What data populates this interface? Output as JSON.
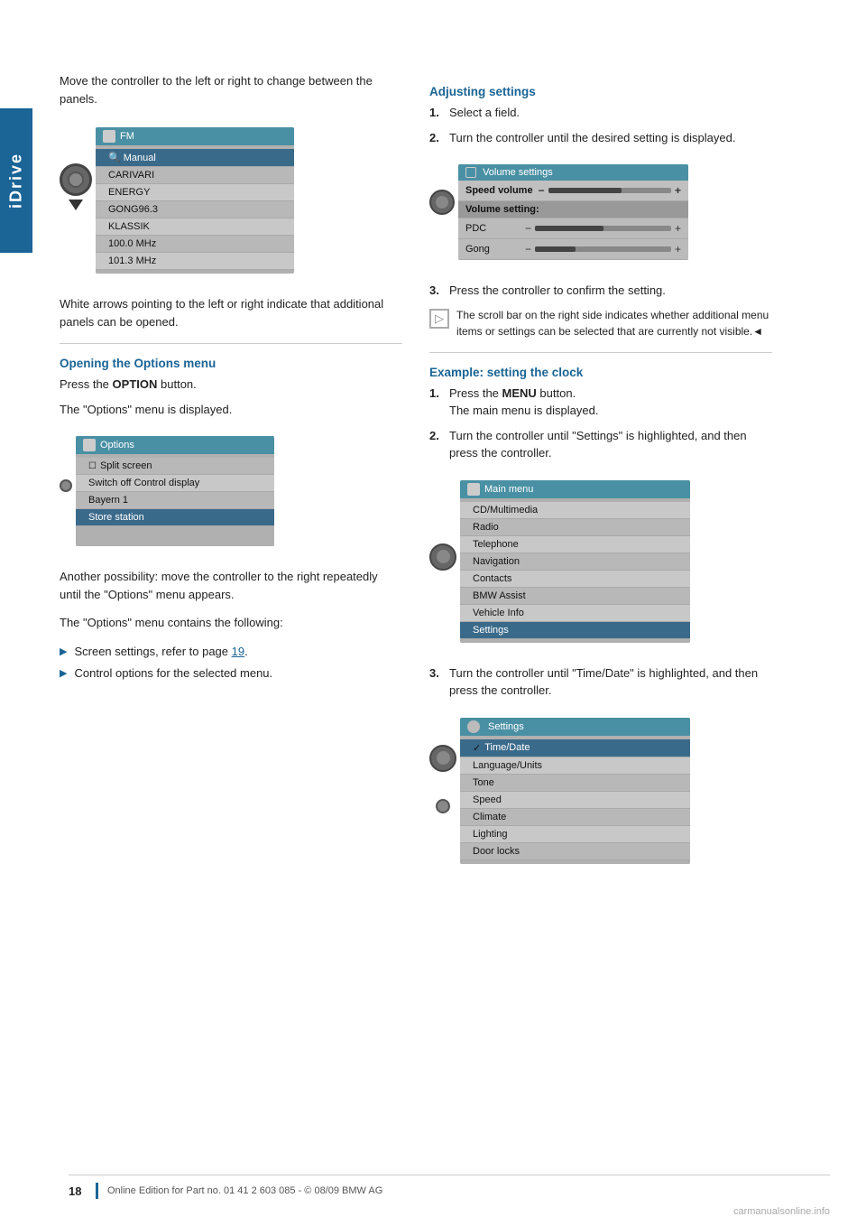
{
  "page": {
    "idrive_label": "iDrive",
    "page_number": "18",
    "footer_text": "Online Edition for Part no. 01 41 2 603 085 - © 08/09 BMW AG"
  },
  "left_column": {
    "intro_text": "Move the controller to the left or right to change between the panels.",
    "fm_screen": {
      "header": "FM",
      "rows": [
        {
          "label": "Manual",
          "style": "highlighted"
        },
        {
          "label": "CARIVARI",
          "style": "normal"
        },
        {
          "label": "ENERGY",
          "style": "normal"
        },
        {
          "label": "GONG96.3",
          "style": "normal"
        },
        {
          "label": "KLASSIK",
          "style": "normal"
        },
        {
          "label": "100.0 MHz",
          "style": "normal"
        },
        {
          "label": "101.3 MHz",
          "style": "normal"
        }
      ]
    },
    "arrows_text": "White arrows pointing to the left or right indicate that additional panels can be opened.",
    "options_heading": "Opening the Options menu",
    "options_step1": "Press the",
    "options_step1_bold": "OPTION",
    "options_step1_end": "button.",
    "options_step2": "The \"Options\" menu is displayed.",
    "options_screen": {
      "header": "Options",
      "rows": [
        {
          "label": "Split screen",
          "icon": "checkbox",
          "style": "normal"
        },
        {
          "label": "Switch off Control display",
          "style": "normal"
        },
        {
          "label": "Bayern 1",
          "style": "normal"
        },
        {
          "label": "Store station",
          "style": "highlighted"
        }
      ]
    },
    "another_text": "Another possibility: move the controller to the right repeatedly until the \"Options\" menu appears.",
    "contains_text": "The \"Options\" menu contains the following:",
    "bullets": [
      {
        "text": "Screen settings, refer to page ",
        "link": "19",
        "suffix": "."
      },
      {
        "text": "Control options for the selected menu."
      }
    ]
  },
  "right_column": {
    "adjusting_heading": "Adjusting settings",
    "adjusting_steps": [
      {
        "num": "1.",
        "text": "Select a field."
      },
      {
        "num": "2.",
        "text": "Turn the controller until the desired setting is displayed."
      }
    ],
    "volume_screen": {
      "header": "Volume settings",
      "speed_volume_label": "Speed volume",
      "section_label": "Volume setting:",
      "rows": [
        {
          "label": "PDC",
          "fill": 50
        },
        {
          "label": "Gong",
          "fill": 30
        }
      ]
    },
    "step3_text": "Press the controller to confirm the setting.",
    "note_text": "The scroll bar on the right side indicates whether additional menu items or settings can be selected that are currently not visible.◄",
    "example_heading": "Example: setting the clock",
    "example_steps": [
      {
        "num": "1.",
        "text1": "Press the ",
        "bold": "MENU",
        "text2": " button.\nThe main menu is displayed."
      },
      {
        "num": "2.",
        "text": "Turn the controller until \"Settings\" is highlighted, and then press the controller."
      }
    ],
    "main_menu_screen": {
      "header": "Main menu",
      "rows": [
        {
          "label": "CD/Multimedia",
          "style": "normal"
        },
        {
          "label": "Radio",
          "style": "normal"
        },
        {
          "label": "Telephone",
          "style": "normal"
        },
        {
          "label": "Navigation",
          "style": "normal"
        },
        {
          "label": "Contacts",
          "style": "normal"
        },
        {
          "label": "BMW Assist",
          "style": "normal"
        },
        {
          "label": "Vehicle Info",
          "style": "normal"
        },
        {
          "label": "Settings",
          "style": "highlighted"
        }
      ]
    },
    "step3_clock": "Turn the controller until \"Time/Date\" is highlighted, and then press the controller.",
    "settings_screen": {
      "header": "Settings",
      "rows": [
        {
          "label": "Time/Date",
          "style": "highlighted",
          "check": true
        },
        {
          "label": "Language/Units",
          "style": "normal"
        },
        {
          "label": "Tone",
          "style": "normal"
        },
        {
          "label": "Speed",
          "style": "normal"
        },
        {
          "label": "Climate",
          "style": "normal"
        },
        {
          "label": "Lighting",
          "style": "normal"
        },
        {
          "label": "Door locks",
          "style": "normal"
        }
      ]
    }
  }
}
